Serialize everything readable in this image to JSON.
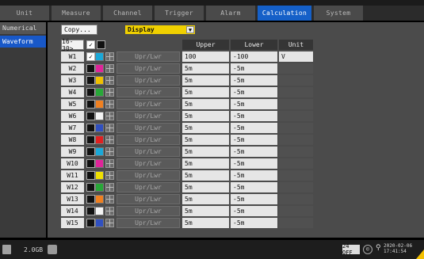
{
  "tabs": [
    {
      "label": "Unit"
    },
    {
      "label": "Measure"
    },
    {
      "label": "Channel"
    },
    {
      "label": "Trigger"
    },
    {
      "label": "Alarm"
    },
    {
      "label": "Calculation",
      "active": true
    },
    {
      "label": "System"
    }
  ],
  "sidebar": {
    "items": [
      {
        "label": "Numerical"
      },
      {
        "label": "Waveform",
        "active": true
      }
    ]
  },
  "toolbar": {
    "copy_label": "Copy...",
    "display_value": "Display",
    "arrow_glyph": "▼"
  },
  "table": {
    "range_label": "16-30>",
    "columns": {
      "upper": "Upper",
      "lower": "Lower",
      "unit": "Unit"
    },
    "button_label": "Upr/Lwr",
    "rows": [
      {
        "label": "W1",
        "checked": true,
        "color": "#1aa8d8",
        "upper": "100",
        "lower": "-100",
        "unit": "V"
      },
      {
        "label": "W2",
        "checked": false,
        "color": "#e0249a",
        "upper": "5m",
        "lower": "-5m",
        "unit": ""
      },
      {
        "label": "W3",
        "checked": false,
        "color": "#f0c000",
        "upper": "5m",
        "lower": "-5m",
        "unit": ""
      },
      {
        "label": "W4",
        "checked": false,
        "color": "#28a838",
        "upper": "5m",
        "lower": "-5m",
        "unit": ""
      },
      {
        "label": "W5",
        "checked": false,
        "color": "#f08020",
        "upper": "5m",
        "lower": "-5m",
        "unit": ""
      },
      {
        "label": "W6",
        "checked": false,
        "color": "#f4f4f4",
        "upper": "5m",
        "lower": "-5m",
        "unit": ""
      },
      {
        "label": "W7",
        "checked": false,
        "color": "#3050c0",
        "upper": "5m",
        "lower": "-5m",
        "unit": ""
      },
      {
        "label": "W8",
        "checked": false,
        "color": "#e02020",
        "upper": "5m",
        "lower": "-5m",
        "unit": ""
      },
      {
        "label": "W9",
        "checked": false,
        "color": "#1aa8d8",
        "upper": "5m",
        "lower": "-5m",
        "unit": ""
      },
      {
        "label": "W10",
        "checked": false,
        "color": "#e0249a",
        "upper": "5m",
        "lower": "-5m",
        "unit": ""
      },
      {
        "label": "W11",
        "checked": false,
        "color": "#f0e000",
        "upper": "5m",
        "lower": "-5m",
        "unit": ""
      },
      {
        "label": "W12",
        "checked": false,
        "color": "#28a838",
        "upper": "5m",
        "lower": "-5m",
        "unit": ""
      },
      {
        "label": "W13",
        "checked": false,
        "color": "#f08020",
        "upper": "5m",
        "lower": "-5m",
        "unit": ""
      },
      {
        "label": "W14",
        "checked": false,
        "color": "#f4f4f4",
        "upper": "5m",
        "lower": "-5m",
        "unit": ""
      },
      {
        "label": "W15",
        "checked": false,
        "color": "#3050c0",
        "upper": "5m",
        "lower": "-5m",
        "unit": ""
      }
    ]
  },
  "status": {
    "storage": "2.0GB",
    "channel_indicator": "24 OFF",
    "datetime_line1": "2020-02-06",
    "datetime_line2": "17:41:54",
    "icons": [
      "drive-icon",
      "printer-icon",
      "copyright-icon",
      "antenna-icon",
      "warning-corner-icon"
    ]
  }
}
